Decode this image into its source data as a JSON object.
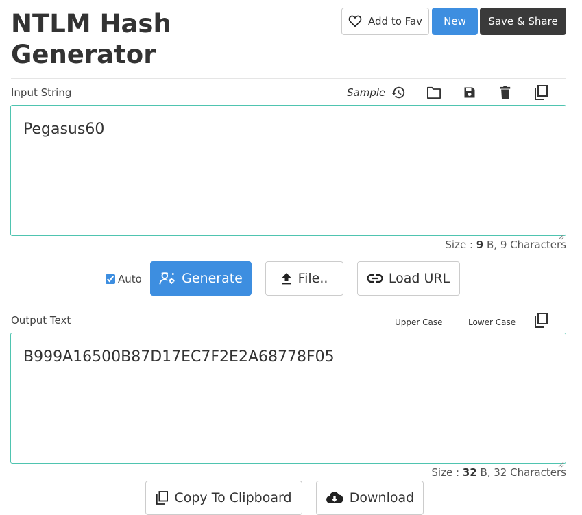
{
  "header": {
    "title": "NTLM Hash Generator",
    "fav_label": "Add to Fav",
    "new_label": "New",
    "save_label": "Save & Share"
  },
  "input": {
    "label": "Input String",
    "sample_label": "Sample",
    "value": "Pegasus60",
    "size_prefix": "Size : ",
    "size_bytes": "9",
    "size_suffix": " B, 9 Characters"
  },
  "controls": {
    "auto_label": "Auto",
    "auto_checked": true,
    "generate_label": "Generate",
    "file_label": "File..",
    "load_url_label": "Load URL"
  },
  "output": {
    "label": "Output Text",
    "upper_case_label": "Upper Case",
    "lower_case_label": "Lower Case",
    "value": "B999A16500B87D17EC7F2E2A68778F05",
    "size_prefix": "Size : ",
    "size_bytes": "32",
    "size_suffix": " B, 32 Characters"
  },
  "footer": {
    "copy_label": "Copy To Clipboard",
    "download_label": "Download"
  },
  "icons": {
    "fav": "heart-icon",
    "history": "history-icon",
    "open": "folder-icon",
    "save": "save-icon",
    "delete": "trash-icon",
    "copy": "copy-icon",
    "generate": "user-gear-icon",
    "file": "upload-icon",
    "url": "link-icon",
    "download": "cloud-download-icon"
  },
  "colors": {
    "primary": "#3d8ee0",
    "dark": "#3a3a3a",
    "textbox_border": "#4fc4b0"
  }
}
